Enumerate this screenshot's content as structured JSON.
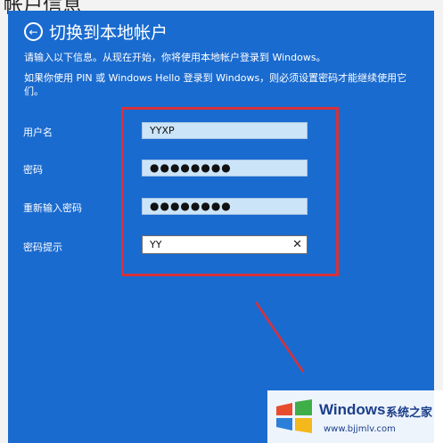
{
  "background_window": {
    "title_partial": "帐户信息"
  },
  "dialog": {
    "title": "切换到本地帐户",
    "info_line1": "请输入以下信息。从现在开始，你将使用本地帐户登录到 Windows。",
    "info_line2": "如果你使用 PIN 或 Windows Hello 登录到 Windows，则必须设置密码才能继续使用它们。"
  },
  "form": {
    "username_label": "用户名",
    "username_value": "YYXP",
    "password_label": "密码",
    "password_value": "●●●●●●●●",
    "confirm_label": "重新输入密码",
    "confirm_value": "●●●●●●●●",
    "hint_label": "密码提示",
    "hint_value": "YY"
  },
  "watermark": {
    "brand": "Windows",
    "cn_text": "系统之家",
    "url": "www.bjjmlv.com"
  },
  "colors": {
    "dialog_bg": "#1a6bcf",
    "highlight": "#d8313a"
  }
}
